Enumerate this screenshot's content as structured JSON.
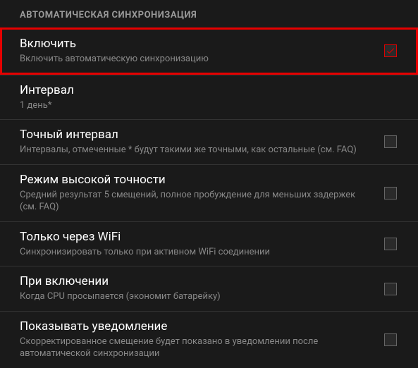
{
  "section_header": "АВТОМАТИЧЕСКАЯ СИНХРОНИЗАЦИЯ",
  "settings": [
    {
      "title": "Включить",
      "subtitle": "Включить автоматическую синхронизацию",
      "has_checkbox": true,
      "checked": true,
      "highlighted": true
    },
    {
      "title": "Интервал",
      "subtitle": "1 день*",
      "has_checkbox": false,
      "checked": false,
      "highlighted": false
    },
    {
      "title": "Точный интервал",
      "subtitle": "Интервалы, отмеченные * будут такими же точными, как остальные (см. FAQ)",
      "has_checkbox": true,
      "checked": false,
      "highlighted": false
    },
    {
      "title": "Режим высокой точности",
      "subtitle": "Средний результат 5 смещений, полное пробуждение для меньших задержек (см. FAQ)",
      "has_checkbox": true,
      "checked": false,
      "highlighted": false
    },
    {
      "title": "Только через WiFi",
      "subtitle": "Синхронизировать только при активном WiFi соединении",
      "has_checkbox": true,
      "checked": false,
      "highlighted": false
    },
    {
      "title": "При включении",
      "subtitle": "Когда CPU просыпается (экономит батарейку)",
      "has_checkbox": true,
      "checked": false,
      "highlighted": false
    },
    {
      "title": "Показывать уведомление",
      "subtitle": "Скорректированное смещение будет показано в уведомлении после автоматической синхронизации",
      "has_checkbox": true,
      "checked": false,
      "highlighted": false
    }
  ]
}
